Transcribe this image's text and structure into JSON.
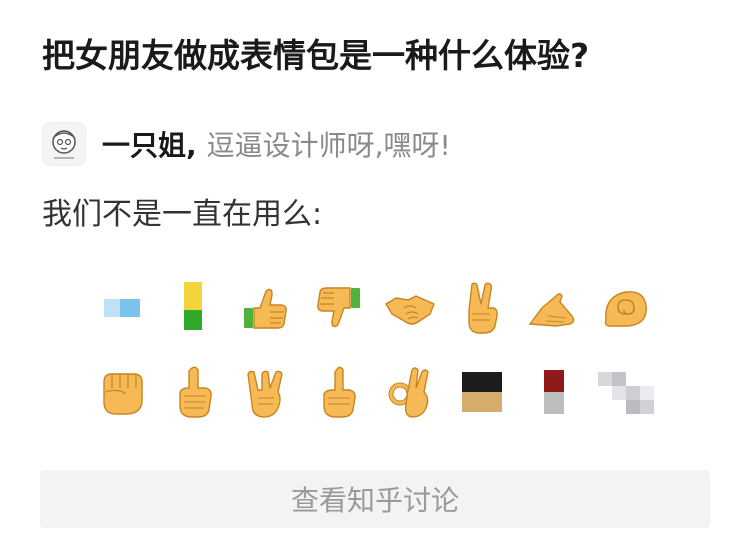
{
  "question": {
    "title": "把女朋友做成表情包是一种什么体验?"
  },
  "author": {
    "name": "一只姐,",
    "bio": "逗逼设计师呀,嘿呀!"
  },
  "answer": {
    "text": "我们不是一直在用么:"
  },
  "emoji": {
    "row1": [
      {
        "icon": "censored-blue-pixel-icon"
      },
      {
        "icon": "censored-yellow-green-pixel-icon"
      },
      {
        "icon": "thumbs-up-icon",
        "glyph": "👍"
      },
      {
        "icon": "thumbs-down-icon",
        "glyph": "👎"
      },
      {
        "icon": "handshake-icon",
        "glyph": "🤝"
      },
      {
        "icon": "victory-hand-icon",
        "glyph": "✌"
      },
      {
        "icon": "pointing-hand-icon",
        "glyph": "👉"
      },
      {
        "icon": "swirl-icon",
        "glyph": "🌀"
      }
    ],
    "row2": [
      {
        "icon": "raised-fist-icon",
        "glyph": "✊"
      },
      {
        "icon": "pointing-up-icon",
        "glyph": "☝"
      },
      {
        "icon": "rock-on-hand-icon",
        "glyph": "🤟"
      },
      {
        "icon": "finger-point-up-icon",
        "glyph": "☝"
      },
      {
        "icon": "ok-hand-icon",
        "glyph": "👌"
      },
      {
        "icon": "censored-black-gold-pixel-icon"
      },
      {
        "icon": "censored-red-gray-pixel-icon"
      },
      {
        "icon": "censored-gray-pixel-icon"
      }
    ]
  },
  "cta": {
    "label": "查看知乎讨论"
  },
  "colors": {
    "title": "#1a1a1a",
    "bio": "#8a8a8a",
    "cta_bg": "#f3f3f3",
    "cta_text": "#9a9a9a",
    "emoji_skin": "#f5b955"
  }
}
